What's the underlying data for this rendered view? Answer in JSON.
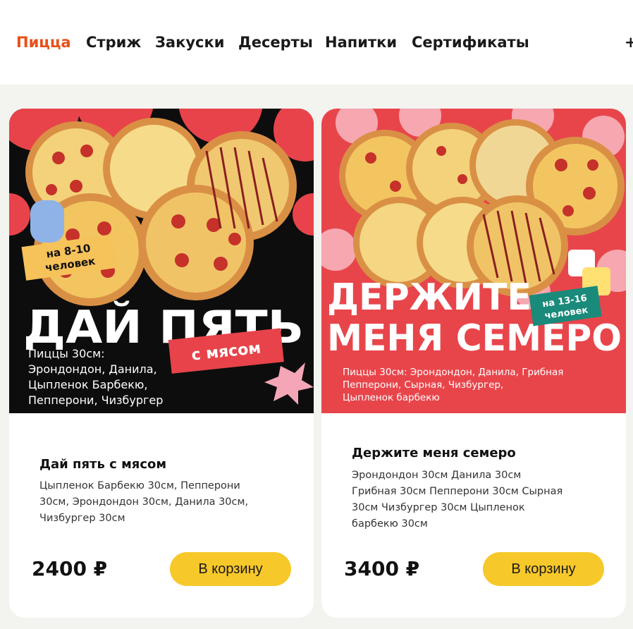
{
  "nav": {
    "items": [
      "Пицца",
      "Стриж",
      "Закуски",
      "Десерты",
      "Напитки",
      "Сертификаты"
    ],
    "more": "+"
  },
  "products": [
    {
      "banner": {
        "badge": [
          "на 8-10",
          "человек"
        ],
        "headline": "ДАЙ ПЯТЬ",
        "sticker": "с мясом",
        "text_lines": [
          "Пиццы 30см:",
          "Эрондондон, Данила,",
          "Цыпленок  Барбекю,",
          "Пепперони, Чизбургер"
        ],
        "colors": {
          "bg": "#0d0d0d",
          "accent": "#e8434a",
          "badge": "#f6c25a"
        }
      },
      "title": "Дай пять с мясом",
      "desc_lines": [
        "Цыпленок Барбекю 30см, Пепперони",
        "30см, Эрондондон 30см, Данила 30см,",
        "Чизбургер 30см"
      ],
      "price": "2400 ₽",
      "button": "В корзину"
    },
    {
      "banner": {
        "badge": [
          "на 13-16",
          "человек"
        ],
        "headline": [
          "ДЕРЖИТЕ",
          "МЕНЯ СЕМЕРО"
        ],
        "text_lines": [
          "Пиццы 30см: Эрондондон, Данила, Грибная",
          "Пепперони, Сырная, Чизбургер,",
          "Цыпленок барбекю"
        ],
        "colors": {
          "bg": "#e8454b",
          "accent": "#f6a7b0",
          "badge": "#1a8a7a"
        }
      },
      "title": "Держите меня семеро",
      "desc_lines": [
        "Эрондондон 30см Данила 30см",
        "Грибная 30см Пепперони 30см Сырная",
        "30см Чизбургер 30см Цыпленок",
        "барбекю 30см"
      ],
      "price": "3400 ₽",
      "button": "В корзину"
    }
  ]
}
